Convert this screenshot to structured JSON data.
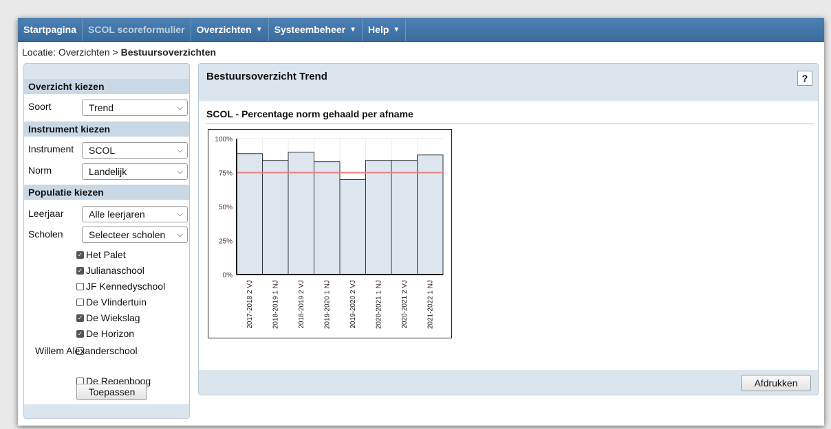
{
  "nav": {
    "items": [
      {
        "label": "Startpagina",
        "dim": false,
        "caret": false
      },
      {
        "label": "SCOL scoreformulier",
        "dim": true,
        "caret": false
      },
      {
        "label": "Overzichten",
        "dim": false,
        "caret": true
      },
      {
        "label": "Systeembeheer",
        "dim": false,
        "caret": true
      },
      {
        "label": "Help",
        "dim": false,
        "caret": true
      }
    ]
  },
  "breadcrumb": {
    "prefix": "Locatie: Overzichten > ",
    "current": "Bestuursoverzichten"
  },
  "sidebar": {
    "overzicht_heading": "Overzicht kiezen",
    "soort_label": "Soort",
    "soort_value": "Trend",
    "instrument_heading": "Instrument kiezen",
    "instrument_label": "Instrument",
    "instrument_value": "SCOL",
    "norm_label": "Norm",
    "norm_value": "Landelijk",
    "populatie_heading": "Populatie kiezen",
    "leerjaar_label": "Leerjaar",
    "leerjaar_value": "Alle leerjaren",
    "scholen_label": "Scholen",
    "scholen_value": "Selecteer scholen",
    "schools": [
      {
        "label": "Het Palet",
        "checked": true
      },
      {
        "label": "Julianaschool",
        "checked": true
      },
      {
        "label": "JF Kennedyschool",
        "checked": false
      },
      {
        "label": "De Vlindertuin",
        "checked": false
      },
      {
        "label": "De Wiekslag",
        "checked": true
      },
      {
        "label": "De Horizon",
        "checked": true
      },
      {
        "label": "Willem Alexanderschool",
        "checked": false
      },
      {
        "label": "De Regenboog",
        "checked": false
      }
    ],
    "apply_label": "Toepassen"
  },
  "main": {
    "title": "Bestuursoverzicht Trend",
    "help_label": "?",
    "chart_heading": "SCOL - Percentage norm gehaald per afname",
    "print_label": "Afdrukken"
  },
  "chart_data": {
    "type": "bar",
    "categories": [
      "2017-2018 2 VJ",
      "2018-2019 1 NJ",
      "2018-2019 2 VJ",
      "2019-2020 1 NJ",
      "2019-2020 2 VJ",
      "2020-2021 1 NJ",
      "2020-2021 2 VJ",
      "2021-2022 1 NJ"
    ],
    "values": [
      89,
      84,
      90,
      83,
      70,
      84,
      84,
      88
    ],
    "reference_line": 75,
    "ylim": [
      0,
      100
    ],
    "yticks": [
      "0%",
      "25%",
      "50%",
      "75%",
      "100%"
    ],
    "bar_color": "#dde6ee",
    "line_color": "#e88080",
    "grid": true
  }
}
